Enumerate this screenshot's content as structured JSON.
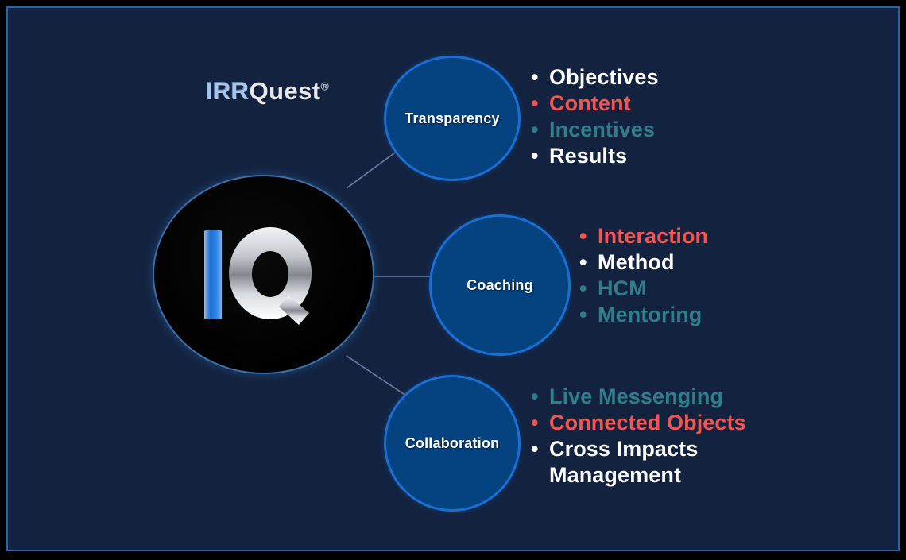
{
  "slide": {
    "background_color": "#13233f",
    "frame_color": "#000000",
    "frame_line_color": "#2a63a8"
  },
  "logo": {
    "part1": "IRR",
    "part2": "Quest",
    "registered_mark": "®",
    "part1_color": "#a8c4e8",
    "part2_color": "#e6e8ec"
  },
  "center_node": {
    "letter_i": "I",
    "letter_q": "Q",
    "letter_i_color": "#2f7fd4",
    "letter_q_color": "#e9ebee",
    "background_color": "#000000"
  },
  "palette": {
    "node_fill": "#044280",
    "node_border": "#1a6fd4",
    "white": "#ffffff",
    "red": "#f4554e",
    "teal": "#2f7e8c",
    "connector": "#7f93b3"
  },
  "branches": [
    {
      "id": "transparency",
      "label": "Transparency",
      "items": [
        {
          "text": "Objectives",
          "color": "white"
        },
        {
          "text": "Content",
          "color": "red"
        },
        {
          "text": "Incentives",
          "color": "teal"
        },
        {
          "text": "Results",
          "color": "white"
        }
      ]
    },
    {
      "id": "coaching",
      "label": "Coaching",
      "items": [
        {
          "text": "Interaction",
          "color": "red"
        },
        {
          "text": "Method",
          "color": "white"
        },
        {
          "text": "HCM",
          "color": "teal"
        },
        {
          "text": "Mentoring",
          "color": "teal"
        }
      ]
    },
    {
      "id": "collaboration",
      "label": "Collaboration",
      "items": [
        {
          "text": "Live Messenging",
          "color": "teal"
        },
        {
          "text": "Connected Objects",
          "color": "red"
        },
        {
          "text": "Cross Impacts\nManagement",
          "color": "white"
        }
      ]
    }
  ],
  "bullet_glyph": "•"
}
